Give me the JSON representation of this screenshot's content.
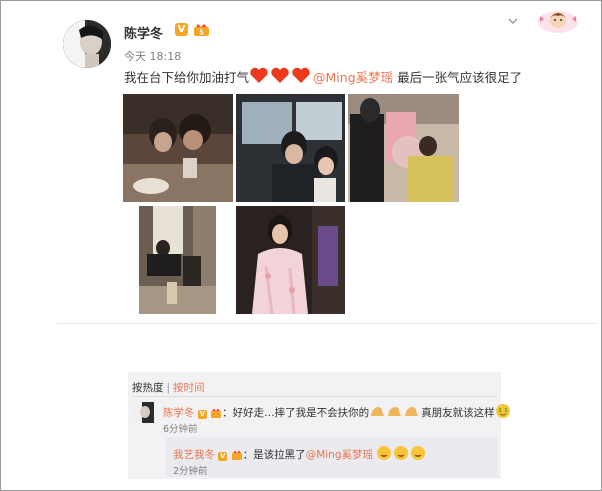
{
  "post": {
    "author": "陈学冬",
    "time": "今天 18:18",
    "text_prefix": "我在台下给你加油打气",
    "mention": "@Ming奚梦瑶",
    "text_suffix": " 最后一张气应该很足了"
  },
  "comments": {
    "tab_hot": "按热度",
    "tab_sep": "|",
    "tab_time": "按时间",
    "items": [
      {
        "user": "陈学冬",
        "text_a": "：好好走…摔了我是不会扶你的",
        "text_b": "真朋友就该这样",
        "time": "6分钟前"
      }
    ],
    "reply": {
      "user": "我艺我冬",
      "text_a": "：是该拉黑了",
      "mention": "@Ming奚梦瑶",
      "time": "2分钟前"
    }
  },
  "colors": {
    "accent": "#eb7350",
    "badge": "#f6a623"
  },
  "icons": [
    "verified-v-icon",
    "vip-crown-icon",
    "chevron-down-icon",
    "heart-icon",
    "muscle-emoji-icon",
    "money-emoji-icon",
    "yum-emoji-icon"
  ]
}
